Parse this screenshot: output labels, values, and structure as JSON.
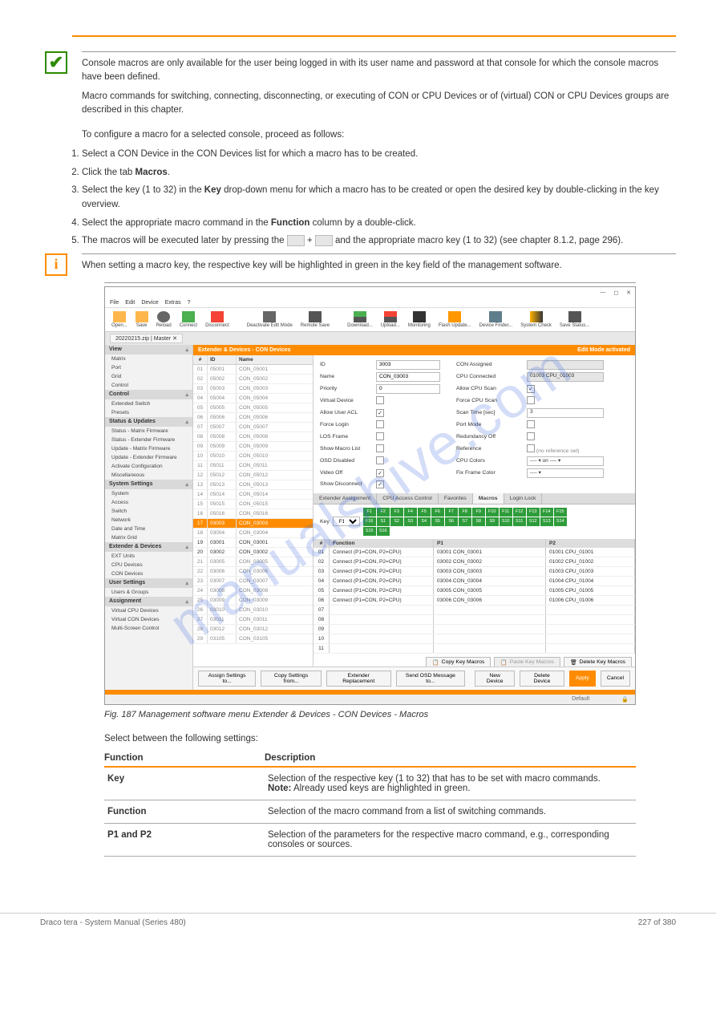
{
  "watermark": "manualshive.com",
  "intro": {
    "line1": "Console macros are only available for the user being logged in with its user name and password at that console for which the console macros have been defined.",
    "line2": "Macro commands for switching, connecting, disconnecting, or executing of CON or CPU Devices or of (virtual) CON or CPU Devices groups are described in this chapter."
  },
  "steps_intro": "To configure a macro for a selected console, proceed as follows:",
  "steps": {
    "0": "Select a CON Device in the CON Devices list for which a macro has to be created.",
    "1a": "Click the tab",
    "1b": "Macros",
    "1c": ".",
    "2a": "Select the key (1 to 32) in the",
    "2b": "Key",
    "2c": "drop-down menu for which a macro has to be created or open the desired key by double-clicking in the key overview.",
    "3a": "Select the appropriate macro command in the",
    "3b": "Function",
    "3c": "column by a double-click.",
    "4a": "The macros will be executed later by pressing the",
    "4b": " and the appropriate macro key (1 to 32) (see chapter 8.1.2, page 296)."
  },
  "info_text": "When setting a macro key, the respective key will be highlighted in green in the key field of the management software.",
  "menus": [
    "File",
    "Edit",
    "Device",
    "Extras",
    "?"
  ],
  "toolbar": [
    "Open...",
    "Save",
    "Reload",
    "Connect",
    "Disconnect",
    "Deactivate Edit Mode",
    "Remote Save",
    "Download...",
    "Upload...",
    "Monitoring",
    "Flash Update...",
    "Device Finder...",
    "System Check",
    "Save Status..."
  ],
  "filetab": "20220215.zip | Master",
  "side": {
    "groups": [
      {
        "name": "View",
        "items": [
          "Matrix",
          "Port",
          "Grid",
          "Control"
        ]
      },
      {
        "name": "Control",
        "items": [
          "Extended Switch",
          "Presets"
        ]
      },
      {
        "name": "Status & Updates",
        "items": [
          "Status - Matrix Firmware",
          "Status - Extender Firmware",
          "Update - Matrix Firmware",
          "Update - Extender Firmware",
          "Activate Configuration",
          "Miscellaneous"
        ]
      },
      {
        "name": "System Settings",
        "items": [
          "System",
          "Access",
          "Switch",
          "Network",
          "Date and Time",
          "Matrix Grid"
        ]
      },
      {
        "name": "Extender & Devices",
        "items": [
          "EXT Units",
          "CPU Devices",
          "CON Devices"
        ]
      },
      {
        "name": "User Settings",
        "items": [
          "Users & Groups"
        ]
      },
      {
        "name": "Assignment",
        "items": [
          "Virtual CPU Devices",
          "Virtual CON Devices",
          "Multi-Screen Control"
        ]
      }
    ]
  },
  "panel": {
    "title": "Extender & Devices - CON Devices",
    "edit_mode": "Edit Mode activated"
  },
  "list": {
    "head": {
      "id": "ID",
      "name": "Name"
    },
    "rows": [
      {
        "n": "01",
        "id": "05001",
        "name": "CON_05001",
        "light": true
      },
      {
        "n": "02",
        "id": "05002",
        "name": "CON_05002",
        "light": true
      },
      {
        "n": "03",
        "id": "05003",
        "name": "CON_05003",
        "light": true
      },
      {
        "n": "04",
        "id": "05004",
        "name": "CON_05004",
        "light": true
      },
      {
        "n": "05",
        "id": "05005",
        "name": "CON_05005",
        "light": true
      },
      {
        "n": "06",
        "id": "05006",
        "name": "CON_05006",
        "light": true
      },
      {
        "n": "07",
        "id": "05007",
        "name": "CON_05007",
        "light": true
      },
      {
        "n": "08",
        "id": "05008",
        "name": "CON_05008",
        "light": true
      },
      {
        "n": "09",
        "id": "05009",
        "name": "CON_05009",
        "light": true
      },
      {
        "n": "10",
        "id": "05010",
        "name": "CON_05010",
        "light": true
      },
      {
        "n": "11",
        "id": "05011",
        "name": "CON_05011",
        "light": true
      },
      {
        "n": "12",
        "id": "05012",
        "name": "CON_05012",
        "light": true
      },
      {
        "n": "13",
        "id": "05013",
        "name": "CON_05013",
        "light": true
      },
      {
        "n": "14",
        "id": "05014",
        "name": "CON_05014",
        "light": true
      },
      {
        "n": "15",
        "id": "05015",
        "name": "CON_05015",
        "light": true
      },
      {
        "n": "16",
        "id": "05016",
        "name": "CON_05016",
        "light": true
      },
      {
        "n": "17",
        "id": "03003",
        "name": "CON_03003",
        "sel": true
      },
      {
        "n": "18",
        "id": "03004",
        "name": "CON_03004",
        "light": true
      },
      {
        "n": "19",
        "id": "03001",
        "name": "CON_03001",
        "dark": true
      },
      {
        "n": "20",
        "id": "03002",
        "name": "CON_03002",
        "dark": true
      },
      {
        "n": "21",
        "id": "03005",
        "name": "CON_03005",
        "light": true
      },
      {
        "n": "22",
        "id": "03006",
        "name": "CON_03006",
        "light": true
      },
      {
        "n": "23",
        "id": "03007",
        "name": "CON_03007",
        "light": true
      },
      {
        "n": "24",
        "id": "03008",
        "name": "CON_03008",
        "light": true
      },
      {
        "n": "25",
        "id": "03009",
        "name": "CON_03009",
        "light": true
      },
      {
        "n": "26",
        "id": "03010",
        "name": "CON_03010",
        "light": true
      },
      {
        "n": "27",
        "id": "03011",
        "name": "CON_03011",
        "light": true
      },
      {
        "n": "28",
        "id": "03012",
        "name": "CON_03012",
        "light": true
      },
      {
        "n": "29",
        "id": "03105",
        "name": "CON_03105",
        "light": true
      }
    ]
  },
  "form": [
    {
      "l": "ID",
      "v": "3003",
      "type": "text",
      "rl": "CON Assigned",
      "rv": "",
      "rtype": "ro"
    },
    {
      "l": "Name",
      "v": "CON_03003",
      "type": "text",
      "rl": "CPU Connected",
      "rv": "01003  CPU_01003",
      "rtype": "ro"
    },
    {
      "l": "Priority",
      "v": "0",
      "type": "spin",
      "rl": "Allow CPU Scan",
      "rv": "✓",
      "rtype": "chk"
    },
    {
      "l": "Virtual Device",
      "v": "",
      "type": "chk",
      "rl": "Force CPU Scan",
      "rv": "",
      "rtype": "chk"
    },
    {
      "l": "Allow User ACL",
      "v": "✓",
      "type": "chk",
      "rl": "Scan Time [sec]",
      "rv": "3",
      "rtype": "spin"
    },
    {
      "l": "Force Login",
      "v": "",
      "type": "chk",
      "rl": "Port Mode",
      "rv": "",
      "rtype": "chk"
    },
    {
      "l": "LOS Frame",
      "v": "",
      "type": "chk",
      "rl": "Redundancy Off",
      "rv": "",
      "rtype": "chk"
    },
    {
      "l": "Show Macro List",
      "v": "",
      "type": "chk",
      "rl": "Reference",
      "rv": "(no reference set)",
      "rtype": "chklbl"
    },
    {
      "l": "OSD Disabled",
      "v": "",
      "type": "chk",
      "rl": "CPU Colors",
      "rv": "---- ▾ on ---- ▾",
      "rtype": "dd"
    },
    {
      "l": "Video Off",
      "v": "✓",
      "type": "chk",
      "rl": "Fix Frame Color",
      "rv": "---- ▾",
      "rtype": "dd"
    },
    {
      "l": "Show Disconnect",
      "v": "✓",
      "type": "chk",
      "rl": "",
      "rv": "",
      "rtype": "none"
    }
  ],
  "subtabs": [
    "Extender Assignment",
    "CPU Access Control",
    "Favorites",
    "Macros",
    "Login Lock"
  ],
  "macro": {
    "key_label": "Key",
    "key_value": "F1",
    "fkeys_top": [
      "F1",
      "F2",
      "F3",
      "F4",
      "F5",
      "F6",
      "F7",
      "F8",
      "F9",
      "F10",
      "F11",
      "F12",
      "F13",
      "F14",
      "F15",
      "F16"
    ],
    "fkeys_bot": [
      "S1",
      "S2",
      "S3",
      "S4",
      "S5",
      "S6",
      "S7",
      "S8",
      "S9",
      "S10",
      "S11",
      "S12",
      "S13",
      "S14",
      "S15",
      "S16"
    ],
    "cols": [
      "Function",
      "P1",
      "P2"
    ],
    "rows": [
      {
        "n": "01",
        "f": "Connect (P1=CON, P2=CPU)",
        "p1": "03001  CON_03001",
        "p2": "01001  CPU_01001"
      },
      {
        "n": "02",
        "f": "Connect (P1=CON, P2=CPU)",
        "p1": "03002  CON_03002",
        "p2": "01002  CPU_01002"
      },
      {
        "n": "03",
        "f": "Connect (P1=CON, P2=CPU)",
        "p1": "03003  CON_03003",
        "p2": "01003  CPU_01003"
      },
      {
        "n": "04",
        "f": "Connect (P1=CON, P2=CPU)",
        "p1": "03004  CON_03004",
        "p2": "01004  CPU_01004"
      },
      {
        "n": "05",
        "f": "Connect (P1=CON, P2=CPU)",
        "p1": "03005  CON_03005",
        "p2": "01005  CPU_01005"
      },
      {
        "n": "06",
        "f": "Connect (P1=CON, P2=CPU)",
        "p1": "03006  CON_03006",
        "p2": "01006  CPU_01006"
      },
      {
        "n": "07",
        "f": "",
        "p1": "",
        "p2": ""
      },
      {
        "n": "08",
        "f": "",
        "p1": "",
        "p2": ""
      },
      {
        "n": "09",
        "f": "",
        "p1": "",
        "p2": ""
      },
      {
        "n": "10",
        "f": "",
        "p1": "",
        "p2": ""
      },
      {
        "n": "11",
        "f": "",
        "p1": "",
        "p2": ""
      }
    ],
    "btn_copy": "Copy Key Macros",
    "btn_paste": "Paste Key Macros",
    "btn_delete": "Delete Key Macros"
  },
  "bottom": [
    "Assign Settings to...",
    "Copy Settings from...",
    "Extender Replacement",
    "Send OSD Message to...",
    "New Device",
    "Delete Device",
    "Apply",
    "Cancel"
  ],
  "status": {
    "default": "Default"
  },
  "caption": "Fig. 187 Management software menu Extender & Devices - CON Devices - Macros",
  "table_intro": "Select between the following settings:",
  "functable": {
    "head": [
      "Function",
      "Description"
    ],
    "rows": [
      [
        "Key",
        "Selection of the respective key (1 to 32) that has to be set with macro commands.",
        "Note:",
        " Already used keys are highlighted in green."
      ],
      [
        "Function",
        "Selection of the macro command from a list of switching commands."
      ],
      [
        "P1 and P2",
        "Selection of the parameters for the respective macro command, e.g., corresponding consoles or sources."
      ]
    ]
  },
  "footer": {
    "left": "Draco tera - System Manual (Series 480)",
    "right": "227 of 380"
  }
}
